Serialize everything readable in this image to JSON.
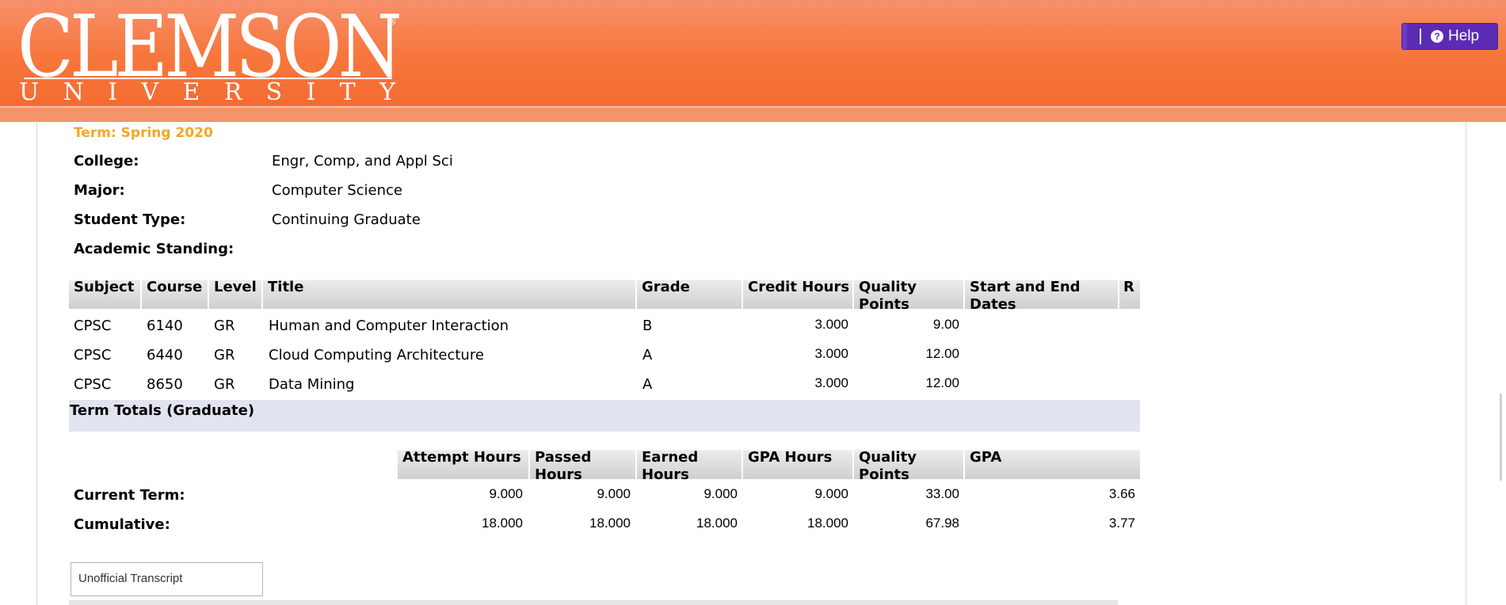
{
  "header": {
    "logo_main": "CLEMSON",
    "logo_reg": "®",
    "logo_sub_letters": [
      "U",
      "N",
      "I",
      "V",
      "E",
      "R",
      "S",
      "I",
      "T",
      "Y"
    ],
    "help_label": "Help",
    "help_icon": "question-circle-icon",
    "colors": {
      "banner": "#f6773d",
      "help": "#5b2bb3",
      "term": "#f5a623"
    }
  },
  "term": {
    "label": "Term: Spring 2020"
  },
  "info": [
    {
      "label": "College:",
      "value": "Engr, Comp, and Appl Sci"
    },
    {
      "label": "Major:",
      "value": "Computer Science"
    },
    {
      "label": "Student Type:",
      "value": "Continuing Graduate"
    },
    {
      "label": "Academic Standing:",
      "value": ""
    }
  ],
  "courses": {
    "headers": {
      "subject": "Subject",
      "course": "Course",
      "level": "Level",
      "title": "Title",
      "grade": "Grade",
      "credit_hours": "Credit Hours",
      "quality_points": "Quality Points",
      "dates": "Start and End Dates",
      "r": "R"
    },
    "rows": [
      {
        "subject": "CPSC",
        "course": "6140",
        "level": "GR",
        "title": "Human and Computer Interaction",
        "grade": "B",
        "credit_hours": "3.000",
        "quality_points": "9.00"
      },
      {
        "subject": "CPSC",
        "course": "6440",
        "level": "GR",
        "title": "Cloud Computing Architecture",
        "grade": "A",
        "credit_hours": "3.000",
        "quality_points": "12.00"
      },
      {
        "subject": "CPSC",
        "course": "8650",
        "level": "GR",
        "title": "Data Mining",
        "grade": "A",
        "credit_hours": "3.000",
        "quality_points": "12.00"
      }
    ]
  },
  "totals": {
    "title": "Term Totals (Graduate)",
    "headers": {
      "attempt": "Attempt Hours",
      "passed": "Passed Hours",
      "earned": "Earned Hours",
      "gpa_hours": "GPA Hours",
      "quality_points": "Quality Points",
      "gpa": "GPA"
    },
    "rows": [
      {
        "label": "Current Term:",
        "attempt": "9.000",
        "passed": "9.000",
        "earned": "9.000",
        "gpa_hours": "9.000",
        "quality_points": "33.00",
        "gpa": "3.66"
      },
      {
        "label": "Cumulative:",
        "attempt": "18.000",
        "passed": "18.000",
        "earned": "18.000",
        "gpa_hours": "18.000",
        "quality_points": "67.98",
        "gpa": "3.77"
      }
    ]
  },
  "transcript": {
    "selected": "Unofficial Transcript"
  }
}
